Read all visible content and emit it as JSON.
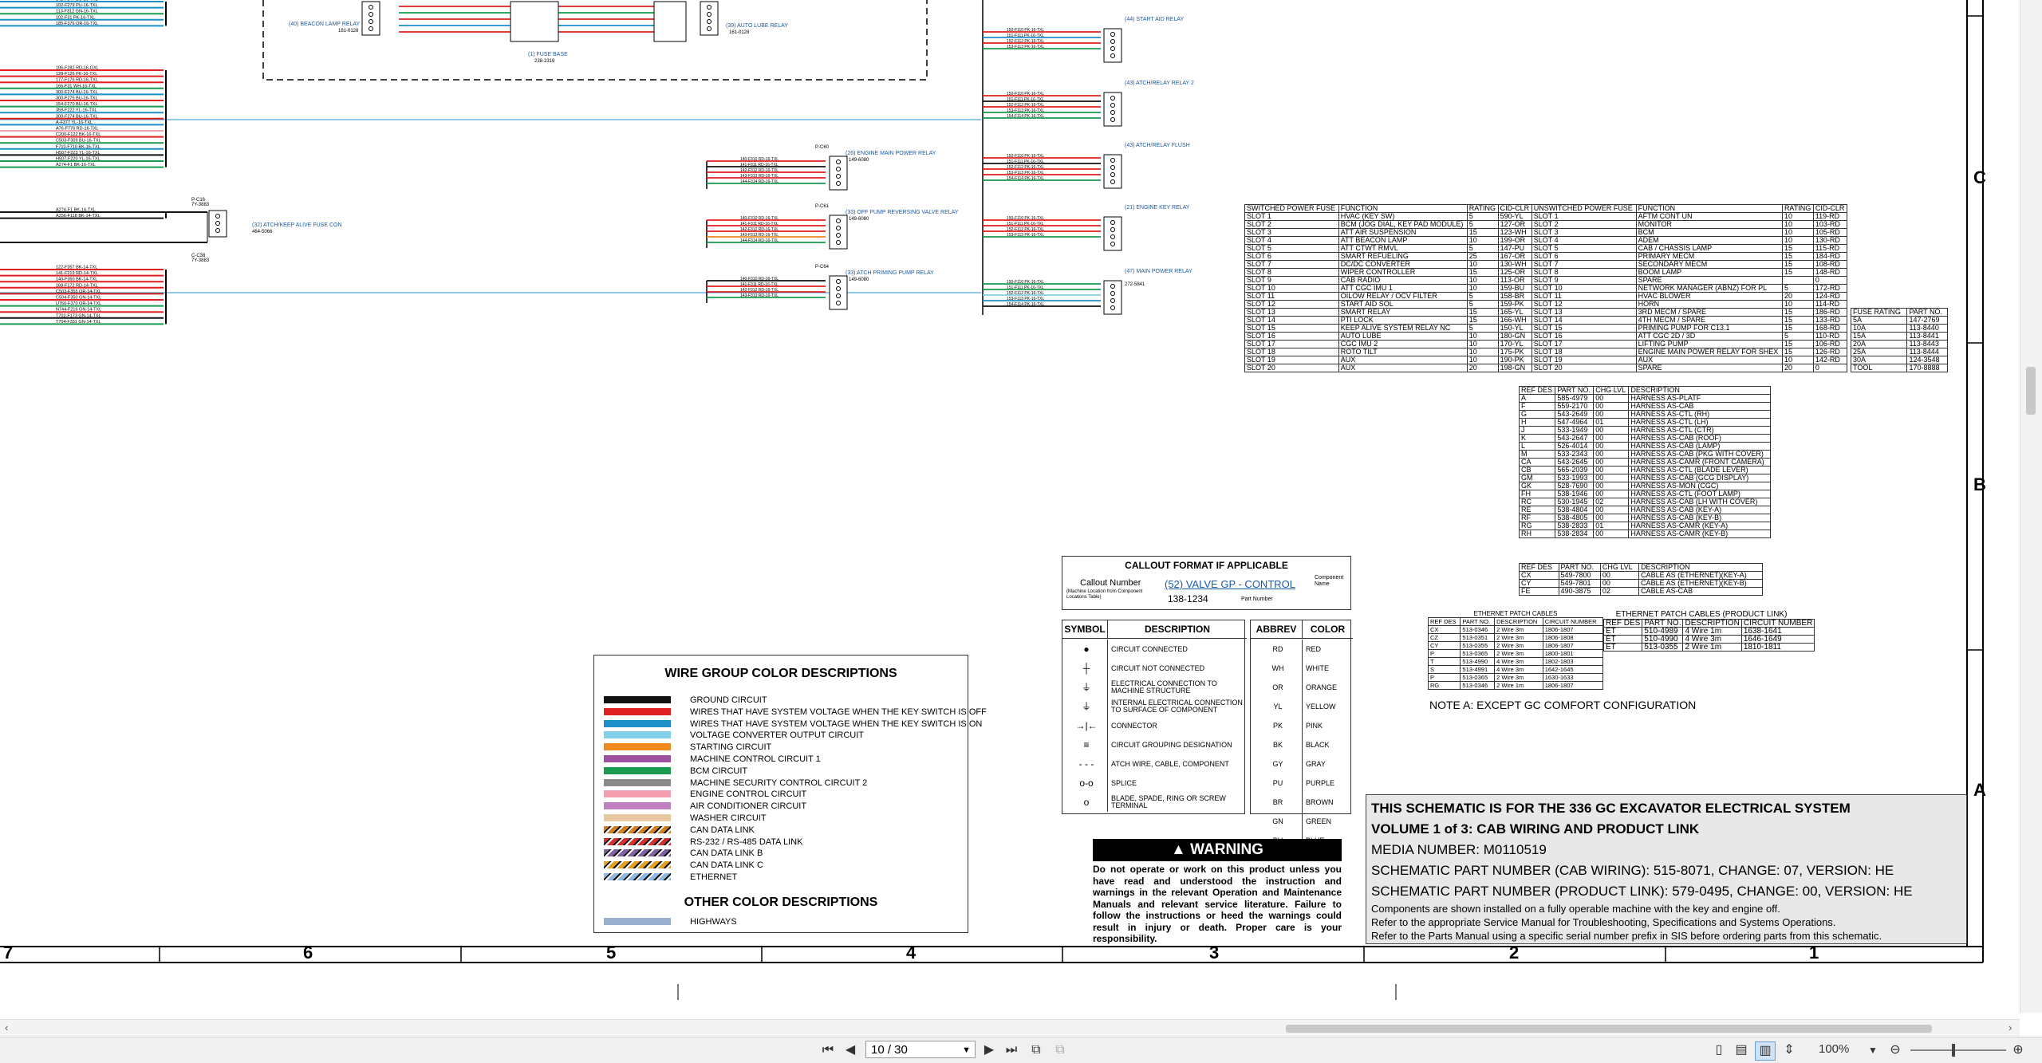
{
  "viewer": {
    "page_field": "10 / 30",
    "zoom": "100%",
    "icons": [
      "first-page-icon",
      "prev-page-icon",
      "next-page-icon",
      "last-page-icon",
      "copy-icon",
      "view-icon",
      "single-page-icon",
      "continuous-icon",
      "two-page-icon",
      "scroll-icon",
      "zoom-out-icon",
      "zoom-in-icon"
    ]
  },
  "schematic": {
    "zones": [
      "C",
      "B",
      "A"
    ],
    "columns": [
      "7",
      "6",
      "5",
      "4",
      "3",
      "2",
      "1"
    ],
    "title_block": {
      "line1": "THIS SCHEMATIC IS FOR THE 336 GC EXCAVATOR ELECTRICAL SYSTEM",
      "line2": "VOLUME 1 of 3: CAB WIRING AND PRODUCT LINK",
      "media": "MEDIA NUMBER: M0110519",
      "part_cab": "SCHEMATIC PART NUMBER (CAB WIRING): 515-8071, CHANGE: 07, VERSION: HE",
      "part_link": "SCHEMATIC PART NUMBER (PRODUCT LINK): 579-0495, CHANGE: 00, VERSION: HE",
      "note1": "Components are shown installed on a fully operable machine with the key and engine off.",
      "note2": "Refer to the appropriate Service Manual for Troubleshooting, Specifications and Systems Operations.",
      "note3": "Refer to the Parts Manual using a specific serial number prefix in SIS before ordering parts from this schematic."
    },
    "wire_legend": {
      "title": "WIRE GROUP COLOR DESCRIPTIONS",
      "rows": [
        {
          "label": "GROUND CIRCUIT",
          "color": "#111111",
          "pattern": "solid"
        },
        {
          "label": "WIRES THAT HAVE SYSTEM VOLTAGE WHEN THE KEY SWITCH IS OFF",
          "color": "#e02020",
          "pattern": "solid"
        },
        {
          "label": "WIRES THAT HAVE SYSTEM VOLTAGE WHEN THE KEY SWITCH IS ON",
          "color": "#1f8fc8",
          "pattern": "solid"
        },
        {
          "label": "VOLTAGE CONVERTER OUTPUT CIRCUIT",
          "color": "#7fd0e8",
          "pattern": "solid"
        },
        {
          "label": "STARTING CIRCUIT",
          "color": "#f08a20",
          "pattern": "solid"
        },
        {
          "label": "MACHINE CONTROL CIRCUIT 1",
          "color": "#a050a0",
          "pattern": "solid"
        },
        {
          "label": "BCM CIRCUIT",
          "color": "#1a9a50",
          "pattern": "solid"
        },
        {
          "label": "MACHINE SECURITY CONTROL CIRCUIT 2",
          "color": "#8a8a8a",
          "pattern": "solid"
        },
        {
          "label": "ENGINE CONTROL CIRCUIT",
          "color": "#f4a0b0",
          "pattern": "solid"
        },
        {
          "label": "AIR CONDITIONER CIRCUIT",
          "color": "#c080c0",
          "pattern": "solid"
        },
        {
          "label": "WASHER CIRCUIT",
          "color": "#e8c8a0",
          "pattern": "solid"
        },
        {
          "label": "CAN DATA LINK",
          "color": "#d08020",
          "pattern": "stripe"
        },
        {
          "label": "RS-232 / RS-485 DATA LINK",
          "color": "#d03030",
          "pattern": "stripe"
        },
        {
          "label": "CAN DATA LINK B",
          "color": "#8060a0",
          "pattern": "stripe"
        },
        {
          "label": "CAN DATA LINK C",
          "color": "#e0a020",
          "pattern": "stripe"
        },
        {
          "label": "ETHERNET",
          "color": "#90b8e0",
          "pattern": "stripe"
        }
      ],
      "other_title": "OTHER COLOR DESCRIPTIONS",
      "other_rows": [
        {
          "label": "HIGHWAYS",
          "color": "#9ab0d0",
          "pattern": "solid"
        }
      ]
    },
    "callout": {
      "title": "CALLOUT FORMAT IF APPLICABLE",
      "callout_number": "Callout Number",
      "callout_sub": "(Machine Location from Component Locations Table)",
      "component": "(52) VALVE GP - CONTROL",
      "component_label": "Component Name",
      "part": "138-1234",
      "part_label": "Part Number"
    },
    "symbols": {
      "headers": [
        "SYMBOL",
        "DESCRIPTION"
      ],
      "rows": [
        "CIRCUIT CONNECTED",
        "CIRCUIT NOT CONNECTED",
        "ELECTRICAL CONNECTION TO MACHINE STRUCTURE",
        "INTERNAL ELECTRICAL CONNECTION TO SURFACE OF COMPONENT",
        "CONNECTOR",
        "CIRCUIT GROUPING DESIGNATION",
        "ATCH WIRE, CABLE, COMPONENT",
        "SPLICE",
        "BLADE, SPADE, RING OR SCREW TERMINAL"
      ]
    },
    "abbrev": {
      "headers": [
        "ABBREV",
        "COLOR"
      ],
      "rows": [
        [
          "RD",
          "RED"
        ],
        [
          "WH",
          "WHITE"
        ],
        [
          "OR",
          "ORANGE"
        ],
        [
          "YL",
          "YELLOW"
        ],
        [
          "PK",
          "PINK"
        ],
        [
          "BK",
          "BLACK"
        ],
        [
          "GY",
          "GRAY"
        ],
        [
          "PU",
          "PURPLE"
        ],
        [
          "BR",
          "BROWN"
        ],
        [
          "GN",
          "GREEN"
        ],
        [
          "BU",
          "BLUE"
        ]
      ]
    },
    "warning": {
      "title": "WARNING",
      "text": "Do not operate or work on this product unless you have read and understood the instruction and warnings in the relevant Operation and Maintenance Manuals and relevant service literature. Failure to follow the instructions or heed the warnings could result in injury or death. Proper care is your responsibility."
    },
    "note_a": "NOTE A: EXCEPT GC COMFORT CONFIGURATION",
    "fuse_table": {
      "headers": [
        "SWITCHED POWER FUSE",
        "FUNCTION",
        "RATING",
        "CID-CLR",
        "UNSWITCHED POWER FUSE",
        "FUNCTION",
        "RATING",
        "CID-CLR"
      ],
      "rows": [
        [
          "SLOT 1",
          "HVAC (KEY SW)",
          "5",
          "590-YL",
          "SLOT 1",
          "AFTM CONT UN",
          "10",
          "119-RD"
        ],
        [
          "SLOT 2",
          "BCM (JOG DIAL, KEY PAD MODULE)",
          "5",
          "127-OR",
          "SLOT 2",
          "MONITOR",
          "10",
          "103-RD"
        ],
        [
          "SLOT 3",
          "ATT AIR SUSPENSION",
          "15",
          "123-WH",
          "SLOT 3",
          "BCM",
          "10",
          "105-RD"
        ],
        [
          "SLOT 4",
          "ATT BEACON LAMP",
          "10",
          "199-OR",
          "SLOT 4",
          "ADEM",
          "10",
          "130-RD"
        ],
        [
          "SLOT 5",
          "ATT CTWT RMVL",
          "5",
          "147-PU",
          "SLOT 5",
          "CAB / CHASSIS LAMP",
          "15",
          "115-RD"
        ],
        [
          "SLOT 6",
          "SMART REFUELING",
          "25",
          "167-OR",
          "SLOT 6",
          "PRIMARY MECM",
          "15",
          "184-RD"
        ],
        [
          "SLOT 7",
          "DC/DC CONVERTER",
          "10",
          "130-WH",
          "SLOT 7",
          "SECONDARY MECM",
          "15",
          "108-RD"
        ],
        [
          "SLOT 8",
          "WIPER CONTROLLER",
          "15",
          "125-OR",
          "SLOT 8",
          "BOOM LAMP",
          "15",
          "148-RD"
        ],
        [
          "SLOT 9",
          "CAB RADIO",
          "10",
          "113-OR",
          "SLOT 9",
          "SPARE",
          "",
          "0"
        ],
        [
          "SLOT 10",
          "ATT CGC IMU 1",
          "10",
          "159-BU",
          "SLOT 10",
          "NETWORK MANAGER (ABNZ) FOR PL",
          "5",
          "172-RD"
        ],
        [
          "SLOT 11",
          "OILOW RELAY / OCV FILTER",
          "5",
          "158-BR",
          "SLOT 11",
          "HVAC BLOWER",
          "20",
          "124-RD"
        ],
        [
          "SLOT 12",
          "START AID SOL",
          "5",
          "159-PK",
          "SLOT 12",
          "HORN",
          "10",
          "114-RD"
        ],
        [
          "SLOT 13",
          "SMART RELAY",
          "15",
          "165-YL",
          "SLOT 13",
          "3RD MECM / SPARE",
          "15",
          "186-RD"
        ],
        [
          "SLOT 14",
          "PTI LOCK",
          "15",
          "166-WH",
          "SLOT 14",
          "4TH MECM / SPARE",
          "15",
          "133-RD"
        ],
        [
          "SLOT 15",
          "KEEP ALIVE SYSTEM RELAY NC",
          "5",
          "150-YL",
          "SLOT 15",
          "PRIMING PUMP FOR C13.1",
          "15",
          "168-RD"
        ],
        [
          "SLOT 16",
          "AUTO LUBE",
          "10",
          "180-GN",
          "SLOT 16",
          "ATT CGC 2D / 3D",
          "5",
          "110-RD"
        ],
        [
          "SLOT 17",
          "CGC IMU 2",
          "10",
          "170-YL",
          "SLOT 17",
          "LIFTING PUMP",
          "15",
          "106-RD"
        ],
        [
          "SLOT 18",
          "ROTO TILT",
          "10",
          "175-PK",
          "SLOT 18",
          "ENGINE MAIN POWER RELAY FOR SHEX",
          "15",
          "126-RD"
        ],
        [
          "SLOT 19",
          "AUX",
          "10",
          "190-PK",
          "SLOT 19",
          "AUX",
          "10",
          "142-RD"
        ],
        [
          "SLOT 20",
          "AUX",
          "20",
          "198-GN",
          "SLOT 20",
          "SPARE",
          "20",
          "0"
        ]
      ]
    },
    "fuse_rating": {
      "headers": [
        "FUSE RATING",
        "PART NO."
      ],
      "rows": [
        [
          "5A",
          "147-2769"
        ],
        [
          "10A",
          "113-8440"
        ],
        [
          "15A",
          "113-8441"
        ],
        [
          "20A",
          "113-8443"
        ],
        [
          "25A",
          "113-8444"
        ],
        [
          "30A",
          "124-3548"
        ],
        [
          "TOOL",
          "170-8888"
        ]
      ]
    },
    "harness_table": {
      "headers": [
        "REF DES",
        "PART NO.",
        "CHG LVL",
        "DESCRIPTION"
      ],
      "rows": [
        [
          "A",
          "585-4979",
          "00",
          "HARNESS AS-PLATF"
        ],
        [
          "F",
          "559-2170",
          "00",
          "HARNESS AS-CAB"
        ],
        [
          "G",
          "543-2649",
          "00",
          "HARNESS AS-CTL (RH)"
        ],
        [
          "H",
          "547-4964",
          "01",
          "HARNESS AS-CTL (LH)"
        ],
        [
          "J",
          "533-1949",
          "00",
          "HARNESS AS-CTL (CTR)"
        ],
        [
          "K",
          "543-2647",
          "00",
          "HARNESS AS-CAB (ROOF)"
        ],
        [
          "L",
          "526-4014",
          "00",
          "HARNESS AS-CAB (LAMP)"
        ],
        [
          "M",
          "533-2343",
          "00",
          "HARNESS AS-CAB (PKG WITH COVER)"
        ],
        [
          "CA",
          "543-2645",
          "00",
          "HARNESS AS-CAMR (FRONT CAMERA)"
        ],
        [
          "CB",
          "565-2039",
          "00",
          "HARNESS AS-CTL (BLADE LEVER)"
        ],
        [
          "GM",
          "533-1993",
          "00",
          "HARNESS AS-CAB (GCG DISPLAY)"
        ],
        [
          "GK",
          "528-7690",
          "00",
          "HARNESS AS-MON (CGC)"
        ],
        [
          "FH",
          "538-1946",
          "00",
          "HARNESS AS-CTL (FOOT LAMP)"
        ],
        [
          "RC",
          "530-1945",
          "02",
          "HARNESS AS-CAB (LH WITH COVER)"
        ],
        [
          "RE",
          "538-4804",
          "00",
          "HARNESS AS-CAB (KEY-A)"
        ],
        [
          "RF",
          "538-4805",
          "00",
          "HARNESS AS-CAB (KEY-B)"
        ],
        [
          "RG",
          "538-2833",
          "01",
          "HARNESS AS-CAMR (KEY-A)"
        ],
        [
          "RH",
          "538-2834",
          "00",
          "HARNESS AS-CAMR (KEY-B)"
        ]
      ]
    },
    "cable_table": {
      "headers": [
        "REF DES",
        "PART NO.",
        "CHG LVL",
        "DESCRIPTION"
      ],
      "rows": [
        [
          "CX",
          "549-7800",
          "00",
          "CABLE AS (ETHERNET)(KEY-A)"
        ],
        [
          "CY",
          "549-7801",
          "00",
          "CABLE AS (ETHERNET)(KEY-B)"
        ],
        [
          "FE",
          "490-3875",
          "02",
          "CABLE AS-CAB"
        ]
      ]
    },
    "eth_cables": {
      "title": "ETHERNET PATCH CABLES",
      "headers": [
        "REF DES",
        "PART NO.",
        "DESCRIPTION",
        "CIRCUIT NUMBER"
      ],
      "rows": [
        [
          "CX",
          "513-0346",
          "2 Wire 3m",
          "1806-1807"
        ],
        [
          "CZ",
          "513-0351",
          "2 Wire 3m",
          "1806-1808"
        ],
        [
          "CY",
          "513-0355",
          "2 Wire 3m",
          "1806-1807"
        ],
        [
          "P",
          "513-0365",
          "2 Wire 3m",
          "1800-1801"
        ],
        [
          "T",
          "513-4990",
          "4 Wire 3m",
          "1802-1803"
        ],
        [
          "S",
          "513-4991",
          "4 Wire 3m",
          "1642-1645"
        ],
        [
          "P",
          "513-0365",
          "2 Wire 3m",
          "1630-1633"
        ],
        [
          "RG",
          "513-0346",
          "2 Wire 1m",
          "1806-1807"
        ]
      ]
    },
    "eth_pl_cables": {
      "title": "ETHERNET PATCH CABLES (PRODUCT LINK)",
      "headers": [
        "REF DES",
        "PART NO.",
        "DESCRIPTION",
        "CIRCUIT NUMBER"
      ],
      "rows": [
        [
          "ET",
          "510-4989",
          "4 Wire 1m",
          "1638-1641"
        ],
        [
          "ET",
          "510-4990",
          "4 Wire 3m",
          "1646-1649"
        ],
        [
          "ET",
          "513-0355",
          "2 Wire 1m",
          "1810-1811"
        ]
      ]
    },
    "labels": {
      "beacon_relay": "(40) BEACON LAMP RELAY",
      "beacon_pn": "161-0128",
      "fuse_base": "(1) FUSE BASE",
      "fuse_base_pn": "238-2319",
      "autolube_relay": "(39) AUTO LUBE RELAY",
      "autolube_pn": "161-0128",
      "start_aid_relay": "(44) START AID RELAY",
      "atch_relay_1": "(43) ATCH/RELAY RELAY 2",
      "atch_relay_2": "(43) ATCH/RELAY FLUSH",
      "engine_key_relay": "(21) ENGINE KEY RELAY",
      "main_power_relay": "(47) MAIN POWER RELAY",
      "main_power_pn": "272-5841",
      "engine_main_relay": "(26) ENGINE MAIN POWER RELAY",
      "engine_main_pn": "149-6080",
      "off_pump_relay": "(33) OFF PUMP REVERSING VALVE RELAY",
      "priming_relay": "(33) ATCH PRIMING PUMP RELAY",
      "atch_fuse": "(32) ATCH/KEEP ALIVE FUSE CON",
      "atch_fuse_pn": "464-5066",
      "p_c60": "P-C60",
      "p_c61": "P-C61",
      "p_c64": "P-C64",
      "c_c16": "P-C16",
      "c_c38": "C-C38",
      "n_3883": "7Y-3883",
      "left_wires_1": [
        "142-F347 BU-16-TXL",
        "102-F279 PU-16-TXL",
        "113-F312 GN-16-TXL",
        "102-F31 PK-16-TXL",
        "185-F376 OR-16-TXL"
      ],
      "left_wires_2": [
        "106-F282 RD-16-GXL",
        "128-F126 PK-16-TXL",
        "177-F176 RD-16-TXL",
        "166-F31 WH-16-TXL",
        "300-F274 BU-16-TXL",
        "300-F275 BU-16-TXL",
        "154-F270 BU-16-TXL",
        "359-F222 YL-16-TXL",
        "300-F274 BU-16-TXL",
        "A-F377 YL-16-TXL",
        "A76-F776 RD-16-TXL",
        "C200-F122 BK-16-TXL",
        "C503-F309 BU-16-TXL",
        "F710-F710 BK-16-TXL",
        "H507-F223 YL-16-TXL",
        "H507-F220 YL-16-TXL",
        "A274-F1 BK-16-TXL"
      ],
      "left_wires_3": [
        "A274-F1 BK-14-TXL",
        "A256-F118 BK-14-TXL"
      ],
      "left_wires_4": [
        "122-F357 BK-14-TXL",
        "141-F219 RD-14-TXL",
        "140-F350 BK-14-TXL",
        "168-F172 RD-14-TXL",
        "C503-F355 OR-14-TXL",
        "C504-F350 GN-14-TXL",
        "U760-F370 OR-14-TXL",
        "N744-F216 GN-14-TXL",
        "T702-F173 GN-14-TXL",
        "T704-F331 GN-14-TXL"
      ]
    }
  }
}
